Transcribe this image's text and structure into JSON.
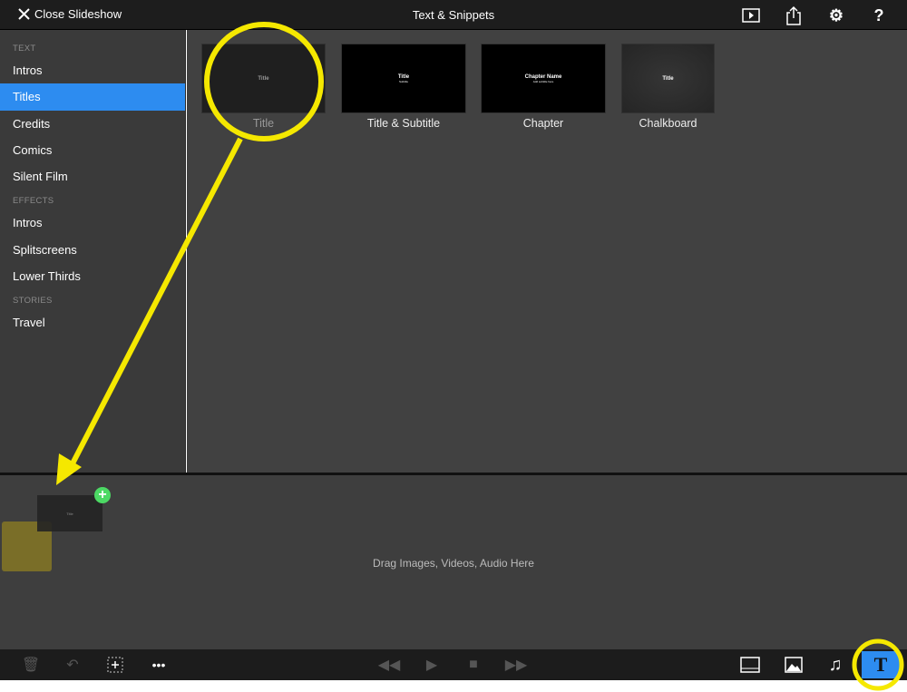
{
  "header": {
    "close_label": "Close Slideshow",
    "title": "Text & Snippets"
  },
  "sidebar": {
    "sections": [
      {
        "label": "TEXT",
        "items": [
          "Intros",
          "Titles",
          "Credits",
          "Comics",
          "Silent Film"
        ]
      },
      {
        "label": "EFFECTS",
        "items": [
          "Intros",
          "Splitscreens",
          "Lower Thirds"
        ]
      },
      {
        "label": "STORIES",
        "items": [
          "Travel"
        ]
      }
    ],
    "selected": "Titles"
  },
  "tiles": [
    {
      "label": "Title",
      "thumb_text": "Title",
      "thumb_sub": ""
    },
    {
      "label": "Title & Subtitle",
      "thumb_text": "Title",
      "thumb_sub": "Subtitle"
    },
    {
      "label": "Chapter",
      "thumb_text": "Chapter Name",
      "thumb_sub": "Add subtitle here"
    },
    {
      "label": "Chalkboard",
      "thumb_text": "Title",
      "thumb_sub": ""
    }
  ],
  "timeline": {
    "placeholder": "Drag Images, Videos, Audio Here",
    "dragged_thumb_text": "Title"
  },
  "toolbar": {
    "active": "text",
    "text_button": "T"
  },
  "colors": {
    "accent": "#2d8cf0",
    "annotation": "#f5e800",
    "add": "#4cd964"
  }
}
